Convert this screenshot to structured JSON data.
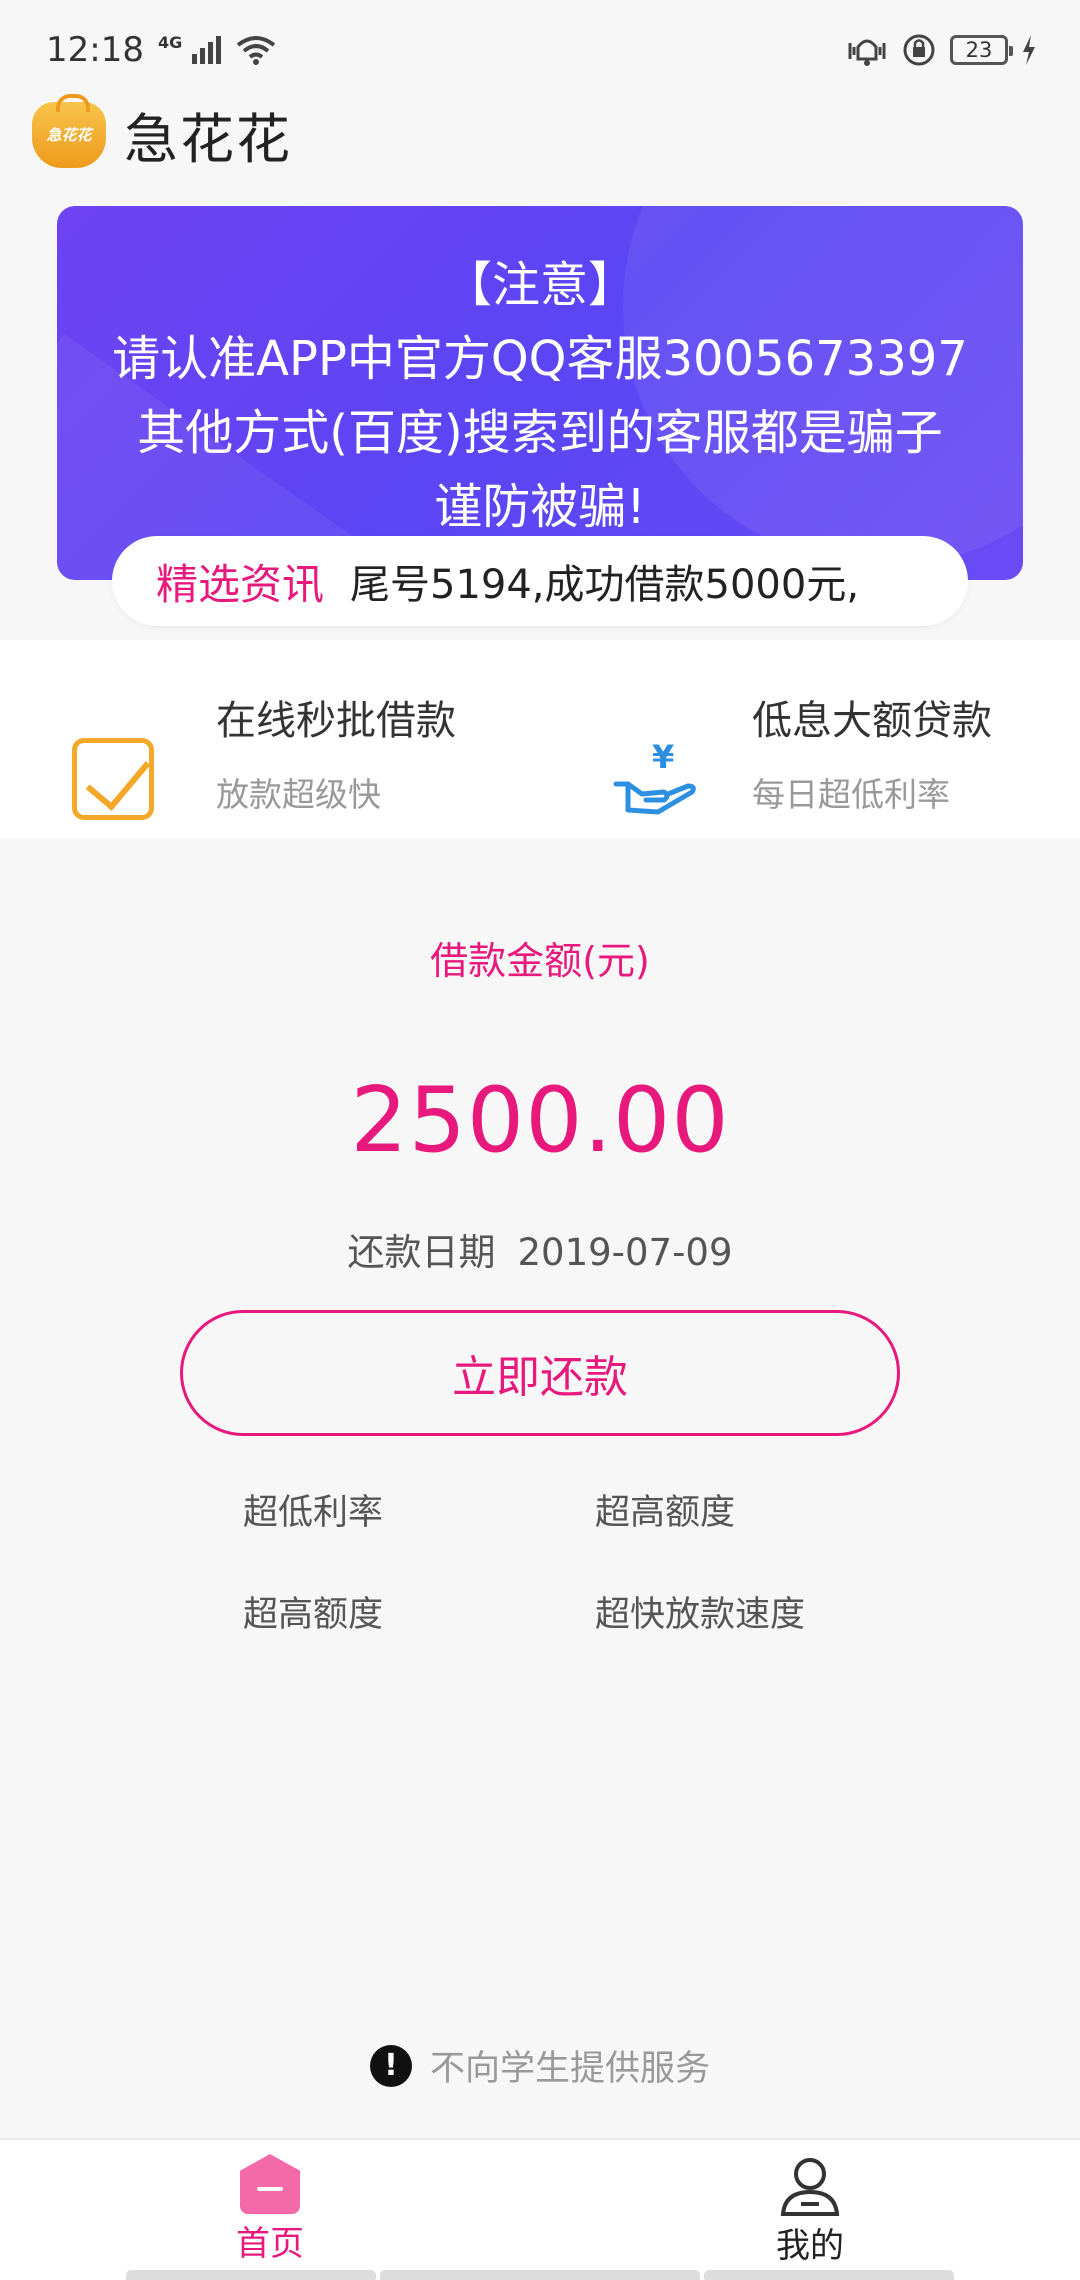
{
  "status_bar": {
    "time": "12:18",
    "network": "4G",
    "battery": "23",
    "icons": [
      "signal-icon",
      "wifi-icon",
      "vibrate-icon",
      "alarm-icon",
      "battery-icon",
      "charging-icon"
    ]
  },
  "app": {
    "name": "急花花",
    "logo_text": "急花花"
  },
  "notice": {
    "lines": [
      "【注意】",
      "请认准APP中官方QQ客服3005673397",
      "其他方式(百度)搜索到的客服都是骗子",
      "谨防被骗!"
    ]
  },
  "news": {
    "label": "精选资讯",
    "text": "尾号5194,成功借款5000元,"
  },
  "features": [
    {
      "title": "在线秒批借款",
      "subtitle": "放款超级快",
      "icon": "checkbox-icon"
    },
    {
      "title": "低息大额贷款",
      "subtitle": "每日超低利率",
      "icon": "yen-hand-icon"
    }
  ],
  "loan": {
    "label": "借款金额(元)",
    "amount": "2500.00",
    "due_label": "还款日期",
    "due_date": "2019-07-09",
    "button_label": "立即还款"
  },
  "perks": [
    "超低利率",
    "超高额度",
    "超高额度",
    "超快放款速度"
  ],
  "footer_notice": "不向学生提供服务",
  "nav": {
    "home": "首页",
    "mine": "我的"
  },
  "colors": {
    "accent": "#e8197c",
    "banner": "#5b45f4",
    "logo": "#f3a82a",
    "icon_blue": "#2d8fe0"
  }
}
